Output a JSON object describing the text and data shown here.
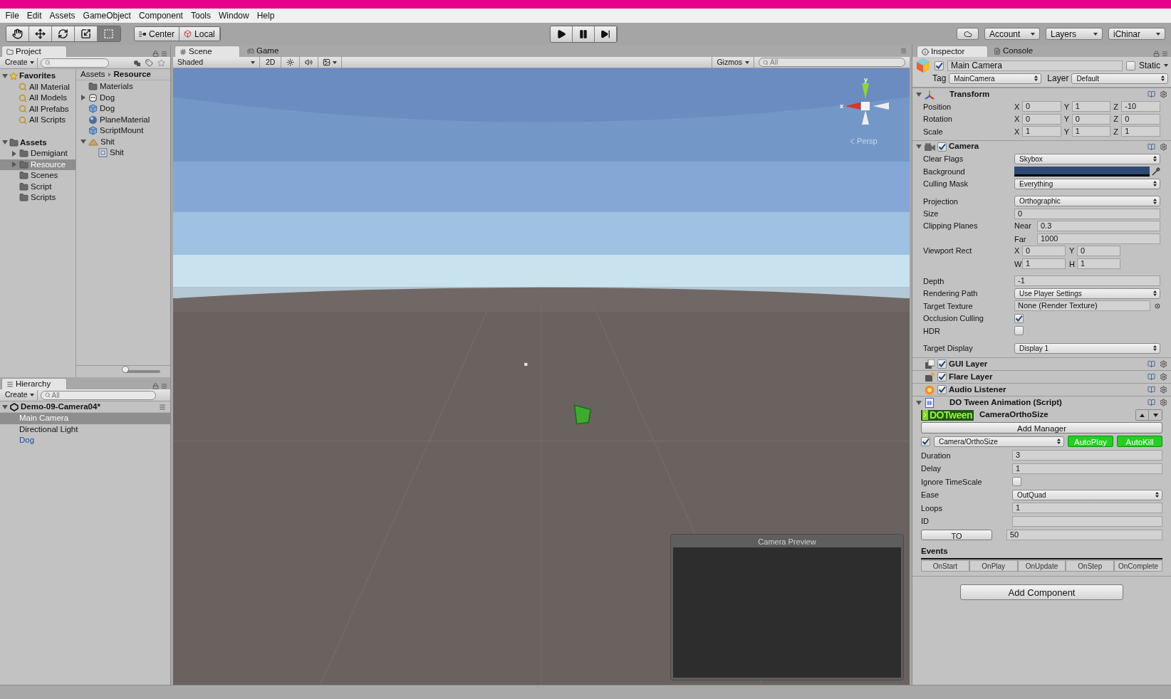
{
  "menu": [
    "File",
    "Edit",
    "Assets",
    "GameObject",
    "Component",
    "Tools",
    "Window",
    "Help"
  ],
  "toolbar": {
    "tools": [
      {
        "kind": "hand",
        "selected": false
      },
      {
        "kind": "move",
        "selected": false
      },
      {
        "kind": "rotate",
        "selected": false
      },
      {
        "kind": "scale",
        "selected": false
      },
      {
        "kind": "rect",
        "selected": true
      }
    ],
    "pivot": [
      {
        "kind": "center",
        "label": "Center"
      },
      {
        "kind": "local",
        "label": "Local"
      }
    ],
    "play_controls": [
      {
        "kind": "play"
      },
      {
        "kind": "pause"
      },
      {
        "kind": "step"
      }
    ],
    "right": [
      "Account",
      "Layers",
      "iChinar"
    ]
  },
  "project": {
    "tab": "Project",
    "create": "Create",
    "favorites": {
      "label": "Favorites",
      "items": [
        "All Material",
        "All Models",
        "All Prefabs",
        "All Scripts"
      ]
    },
    "assets": {
      "label": "Assets",
      "children": [
        {
          "label": "Demigiant",
          "expanded": false,
          "selected": false
        },
        {
          "label": "Resource",
          "expanded": false,
          "selected": true
        },
        {
          "label": "Scenes",
          "selected": false
        },
        {
          "label": "Script",
          "selected": false
        },
        {
          "label": "Scripts",
          "selected": false
        }
      ]
    },
    "breadcrumb": [
      "Assets",
      "Resource"
    ],
    "files": [
      {
        "kind": "folder",
        "label": "Materials"
      },
      {
        "kind": "model",
        "label": "Dog",
        "expanded": false
      },
      {
        "kind": "prefab",
        "label": "Dog"
      },
      {
        "kind": "material",
        "label": "PlaneMaterial"
      },
      {
        "kind": "prefab",
        "label": "ScriptMount"
      },
      {
        "kind": "pile",
        "label": "Shit",
        "expanded": true,
        "children": [
          {
            "kind": "mesh",
            "label": "Shit"
          }
        ]
      }
    ],
    "zoom": {
      "level": 0.05
    }
  },
  "hierarchy": {
    "tab": "Hierarchy",
    "create": "Create",
    "search": {
      "placeholder": "All"
    },
    "scene": "Demo-09-Camera04*",
    "items": [
      {
        "label": "Main Camera",
        "kind": "object",
        "selected": true
      },
      {
        "label": "Directional Light",
        "kind": "object",
        "selected": false
      },
      {
        "label": "Dog",
        "kind": "prefab",
        "selected": false
      }
    ]
  },
  "scene": {
    "tabs": [
      {
        "label": "Scene",
        "kind": "scene",
        "selected": true
      },
      {
        "label": "Game",
        "kind": "game",
        "selected": false
      }
    ],
    "shading": "Shaded",
    "mode_2d": "2D",
    "gizmos": "Gizmos",
    "search": {
      "placeholder": "All"
    },
    "gizmo": {
      "y_label": "y",
      "x_label": "x",
      "projection": "Persp"
    },
    "preview": {
      "title": "Camera Preview"
    }
  },
  "inspector": {
    "tabs": [
      {
        "label": "Inspector",
        "kind": "info",
        "selected": true
      },
      {
        "label": "Console",
        "kind": "console",
        "selected": false
      }
    ],
    "object": {
      "active": true,
      "name": "Main Camera",
      "static": false,
      "static_label": "Static",
      "tag_label": "Tag",
      "tag": "MainCamera",
      "layer_label": "Layer",
      "layer": "Default"
    },
    "transform": {
      "title": "Transform",
      "expanded": true,
      "rows": [
        {
          "label": "Position",
          "values": [
            {
              "axis": "X",
              "value": "0"
            },
            {
              "axis": "Y",
              "value": "1"
            },
            {
              "axis": "Z",
              "value": "-10"
            }
          ]
        },
        {
          "label": "Rotation",
          "values": [
            {
              "axis": "X",
              "value": "0"
            },
            {
              "axis": "Y",
              "value": "0"
            },
            {
              "axis": "Z",
              "value": "0"
            }
          ]
        },
        {
          "label": "Scale",
          "values": [
            {
              "axis": "X",
              "value": "1"
            },
            {
              "axis": "Y",
              "value": "1"
            },
            {
              "axis": "Z",
              "value": "1"
            }
          ]
        }
      ]
    },
    "camera": {
      "title": "Camera",
      "expanded": true,
      "enabled": true,
      "groups": [
        [
          {
            "kind": "select",
            "label": "Clear Flags",
            "value": "Skybox"
          },
          {
            "kind": "color",
            "label": "Background",
            "color": "#2c4a74"
          },
          {
            "kind": "select",
            "label": "Culling Mask",
            "value": "Everything"
          }
        ],
        [
          {
            "kind": "select",
            "label": "Projection",
            "value": "Orthographic"
          },
          {
            "kind": "field",
            "label": "Size",
            "value": "0"
          },
          {
            "kind": "planes",
            "label": "Clipping Planes",
            "parts": [
              {
                "label": "Near",
                "value": "0.3"
              },
              {
                "label": "Far",
                "value": "1000"
              }
            ]
          },
          {
            "kind": "rect",
            "label": "Viewport Rect",
            "parts": [
              {
                "label": "X",
                "value": "0"
              },
              {
                "label": "Y",
                "value": "0"
              },
              {
                "label": "W",
                "value": "1"
              },
              {
                "label": "H",
                "value": "1"
              }
            ]
          }
        ],
        [
          {
            "kind": "field",
            "label": "Depth",
            "value": "-1"
          },
          {
            "kind": "select",
            "label": "Rendering Path",
            "value": "Use Player Settings"
          },
          {
            "kind": "object",
            "label": "Target Texture",
            "value": "None (Render Texture)"
          },
          {
            "kind": "check",
            "label": "Occlusion Culling",
            "checked": true
          },
          {
            "kind": "check",
            "label": "HDR",
            "checked": false
          }
        ],
        [
          {
            "kind": "select",
            "label": "Target Display",
            "value": "Display 1"
          }
        ]
      ]
    },
    "components": [
      {
        "kind": "gui",
        "title": "GUI Layer",
        "enabled": true
      },
      {
        "kind": "flare",
        "title": "Flare Layer",
        "enabled": true
      },
      {
        "kind": "audio",
        "title": "Audio Listener",
        "enabled": true
      }
    ],
    "tween": {
      "title": "DO Tween Animation (Script)",
      "expanded": true,
      "logo": "DOTween",
      "name": "CameraOrthoSize",
      "add_manager": "Add Manager",
      "active": true,
      "target": "Camera/OrthoSize",
      "toggles": [
        {
          "label": "AutoPlay",
          "on": true
        },
        {
          "label": "AutoKill",
          "on": true
        }
      ],
      "rows": [
        {
          "kind": "field",
          "label": "Duration",
          "value": "3"
        },
        {
          "kind": "field",
          "label": "Delay",
          "value": "1"
        },
        {
          "kind": "check",
          "label": "Ignore TimeScale",
          "checked": false
        },
        {
          "kind": "select",
          "label": "Ease",
          "value": "OutQuad"
        },
        {
          "kind": "field",
          "label": "Loops",
          "value": "1"
        },
        {
          "kind": "field",
          "label": "ID"
        }
      ],
      "to_button": "TO",
      "to_value": "50",
      "events_label": "Events",
      "events": [
        "OnStart",
        "OnPlay",
        "OnUpdate",
        "OnStep",
        "OnComplete"
      ]
    },
    "add_component": "Add Component"
  }
}
